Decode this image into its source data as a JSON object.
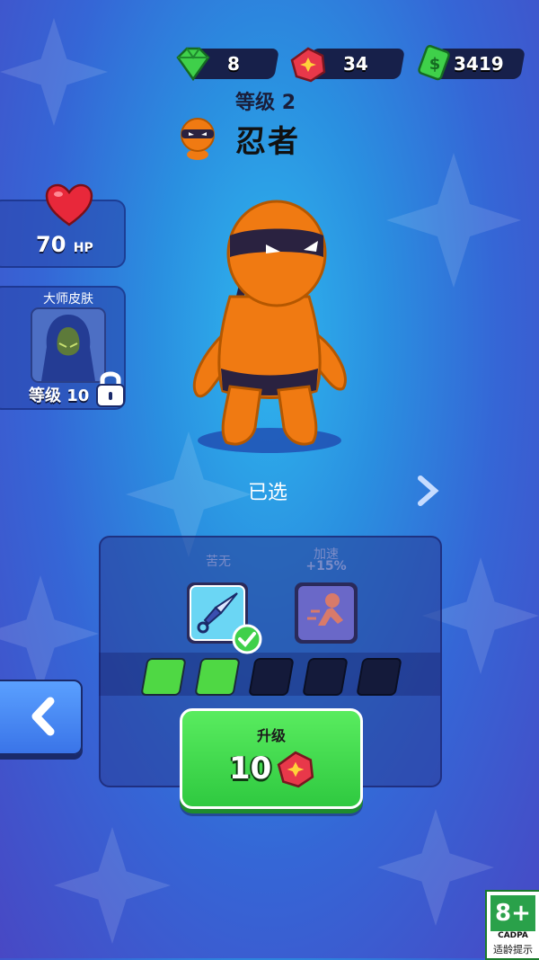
{
  "currencies": {
    "gems": "8",
    "tokens": "34",
    "cash": "3419"
  },
  "character": {
    "level_label": "等级",
    "level_value": "2",
    "name": "忍者"
  },
  "side": {
    "hp_value": "70",
    "hp_unit": "HP",
    "master_skin_title": "大师皮肤",
    "master_skin_level": "等级 10"
  },
  "status": {
    "selected_label": "已选"
  },
  "abilities": {
    "kunai_label": "苦无",
    "speed_label": "加速",
    "speed_bonus": "+15%"
  },
  "progress": {
    "filled": 2,
    "total": 5
  },
  "upgrade": {
    "label": "升级",
    "cost": "10"
  },
  "age_rating": {
    "value": "8+",
    "org": "CADPA",
    "tip": "适龄提示"
  },
  "colors": {
    "accent_green": "#3fd94f",
    "token_red": "#e8384a",
    "character_orange": "#f07a12"
  }
}
